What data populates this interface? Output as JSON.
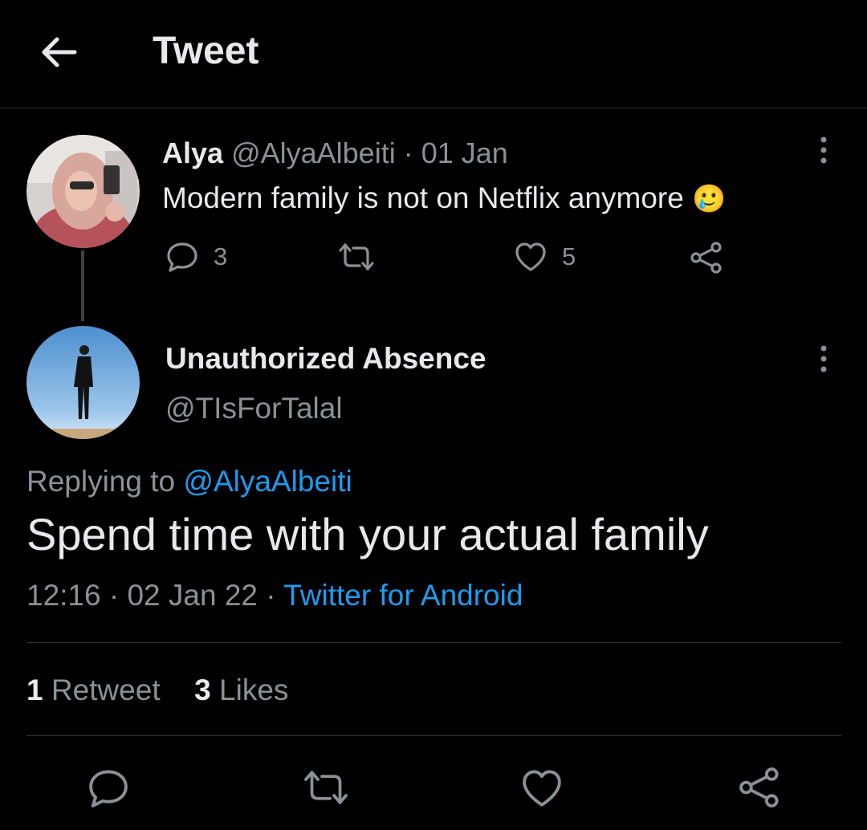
{
  "header": {
    "title": "Tweet"
  },
  "parent_tweet": {
    "name": "Alya",
    "handle": "@AlyaAlbeiti",
    "separator": "·",
    "date": "01 Jan",
    "text": "Modern family is not on Netflix anymore",
    "emoji": "🥲",
    "reply_count": "3",
    "like_count": "5"
  },
  "main_tweet": {
    "name": "Unauthorized Absence",
    "handle": "@TIsForTalal",
    "replying_prefix": "Replying to",
    "replying_handle": "@AlyaAlbeiti",
    "text": "Spend time with your actual family",
    "time": "12:16",
    "sep1": "·",
    "date": "02 Jan 22",
    "sep2": "·",
    "source": "Twitter for Android"
  },
  "stats": {
    "retweets_count": "1",
    "retweets_label": "Retweet",
    "likes_count": "3",
    "likes_label": "Likes"
  },
  "colors": {
    "accent": "#1d9bf0",
    "muted": "#8b9196",
    "text": "#e7e9ea",
    "background": "#000000"
  }
}
